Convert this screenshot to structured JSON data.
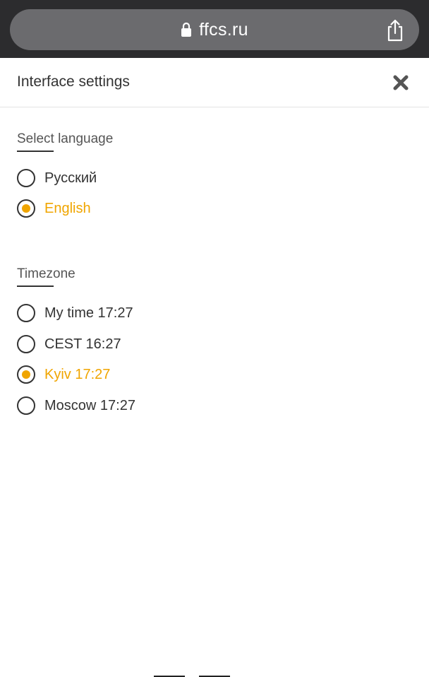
{
  "browser": {
    "url": "ffcs.ru",
    "lock_icon": "lock-icon",
    "share_icon": "share-icon"
  },
  "header": {
    "title": "Interface settings",
    "close_icon": "close-icon"
  },
  "language": {
    "title": "Select language",
    "options": [
      {
        "label": "Русский",
        "selected": false
      },
      {
        "label": "English",
        "selected": true
      }
    ]
  },
  "timezone": {
    "title": "Timezone",
    "options": [
      {
        "label": "My time 17:27",
        "selected": false
      },
      {
        "label": "CEST 16:27",
        "selected": false
      },
      {
        "label": "Kyiv 17:27",
        "selected": true
      },
      {
        "label": "Moscow 17:27",
        "selected": false
      }
    ]
  },
  "colors": {
    "accent": "#f0a500",
    "text": "#333333",
    "browser_bar": "#2c2c2e",
    "url_pill": "#6b6b6e"
  }
}
